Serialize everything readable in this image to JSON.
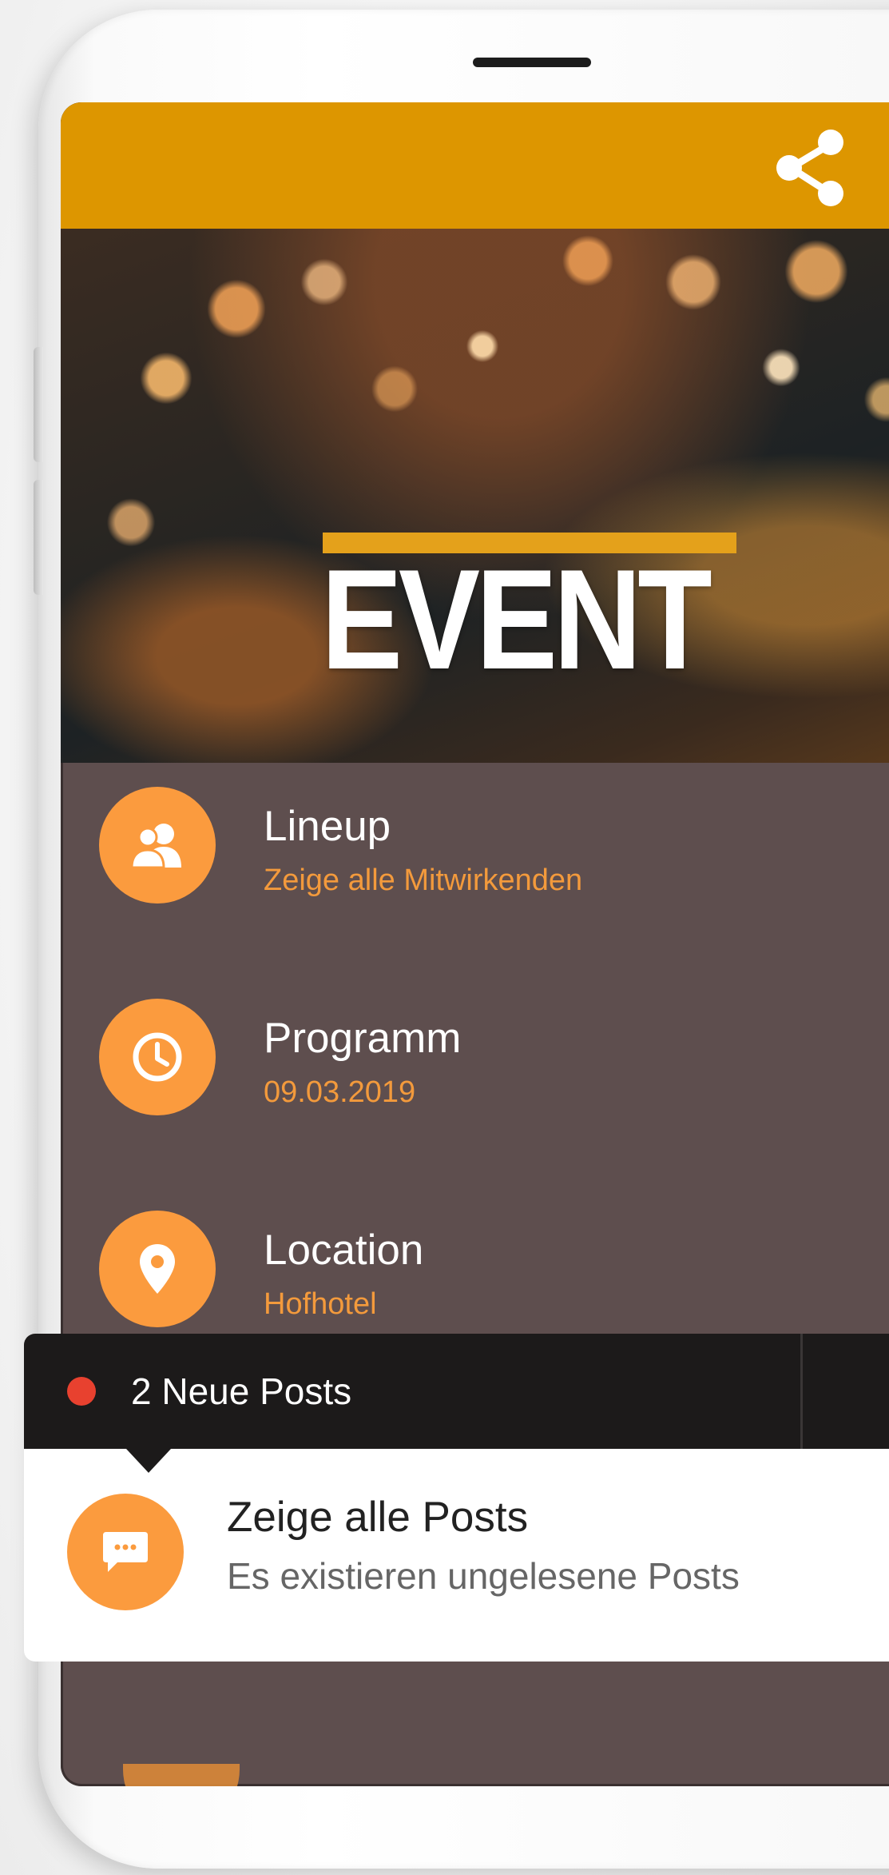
{
  "app": {
    "share_icon": "share-icon",
    "accent_color": "#dd9600",
    "icon_color": "#fb9b3e"
  },
  "hero": {
    "title": "EVENT"
  },
  "menu": {
    "items": [
      {
        "icon": "group-icon",
        "title": "Lineup",
        "subtitle": "Zeige alle Mitwirkenden"
      },
      {
        "icon": "clock-icon",
        "title": "Programm",
        "subtitle": "09.03.2019"
      },
      {
        "icon": "location-pin-icon",
        "title": "Location",
        "subtitle": "Hofhotel"
      }
    ]
  },
  "posts": {
    "count_label": "2 Neue Posts",
    "title": "Zeige alle Posts",
    "subtitle": "Es existieren ungelesene Posts",
    "icon": "chat-bubble-icon",
    "dot_color": "#e8412f"
  }
}
